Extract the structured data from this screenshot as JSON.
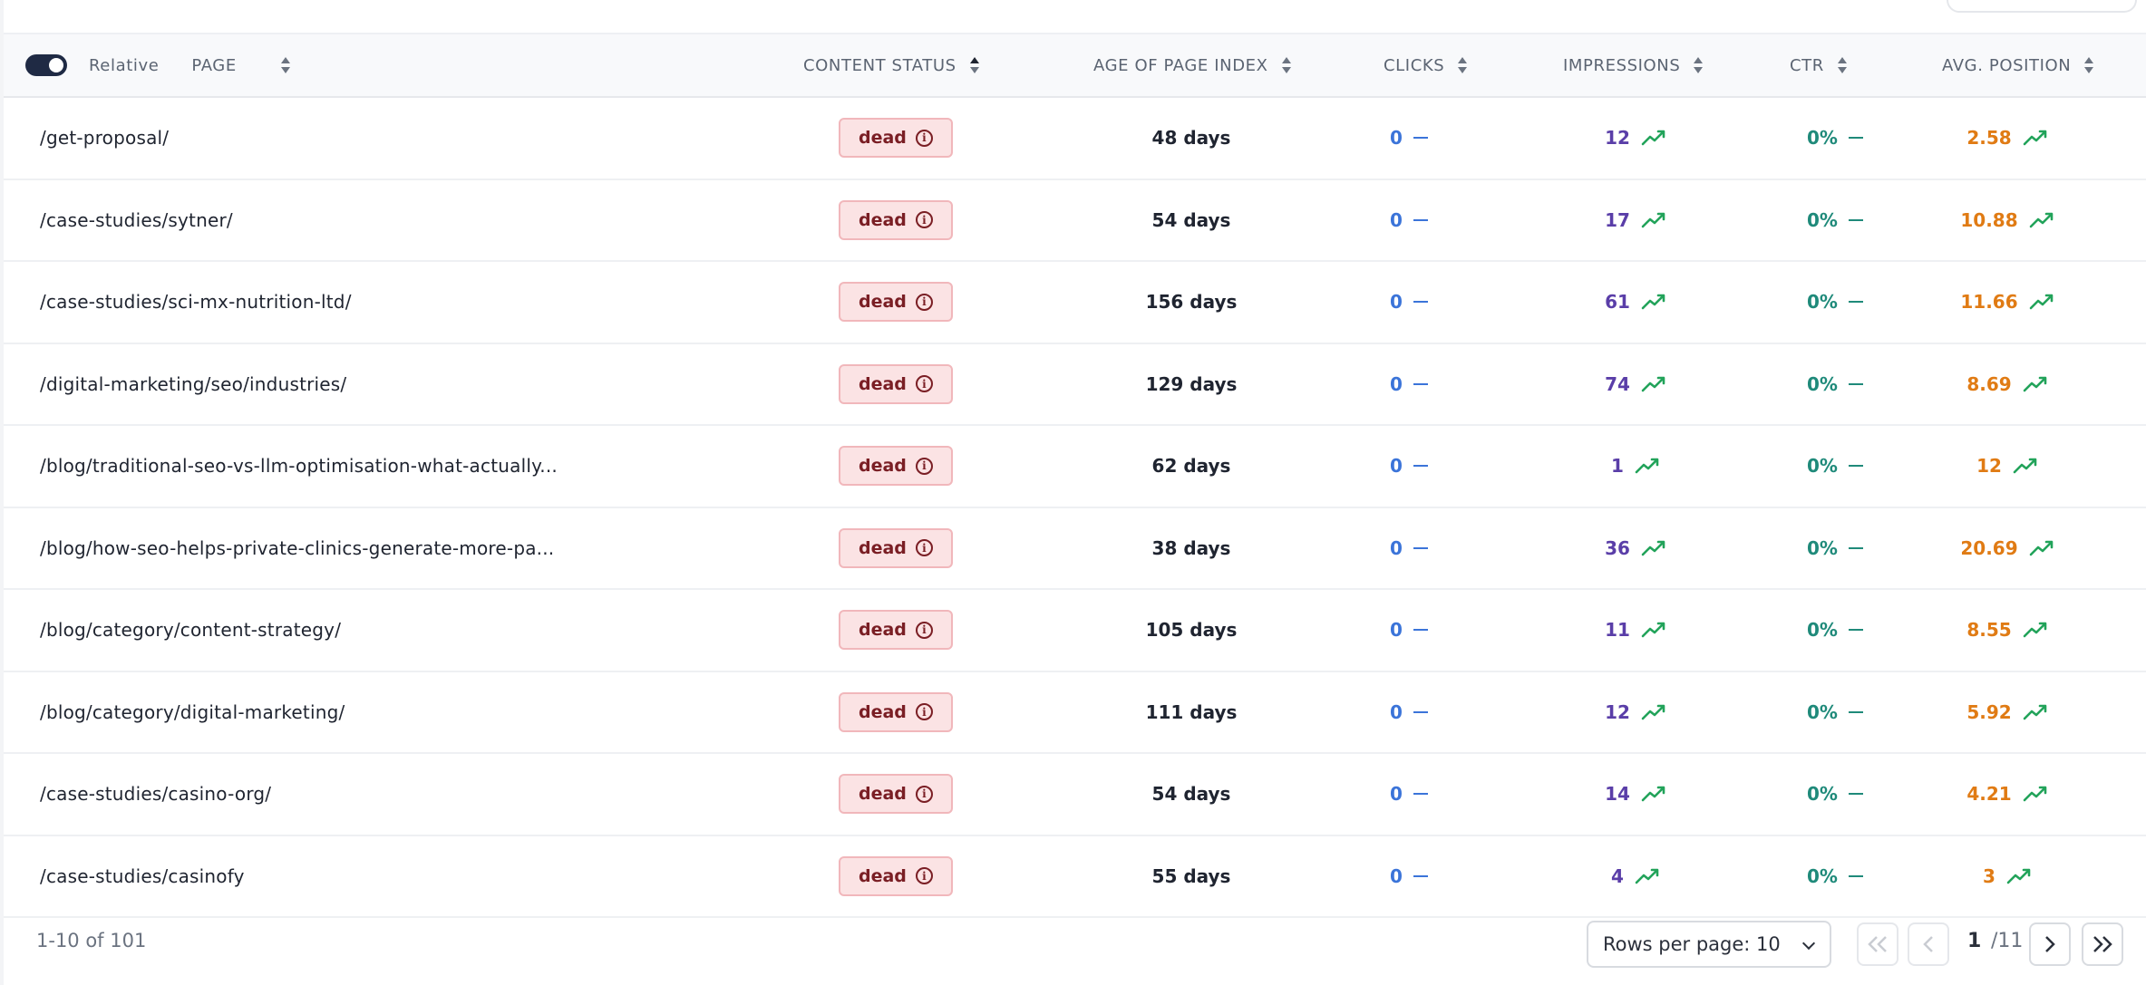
{
  "toggle": {
    "label": "Relative",
    "on": true
  },
  "columns": {
    "page": "PAGE",
    "content_status": "CONTENT STATUS",
    "age": "AGE OF PAGE INDEX",
    "clicks": "CLICKS",
    "impressions": "IMPRESSIONS",
    "ctr": "CTR",
    "avg_position": "AVG. POSITION"
  },
  "rows": [
    {
      "page": "/get-proposal/",
      "status": "dead",
      "age": "48 days",
      "clicks": "0",
      "impressions": "12",
      "ctr": "0%",
      "position": "2.58"
    },
    {
      "page": "/case-studies/sytner/",
      "status": "dead",
      "age": "54 days",
      "clicks": "0",
      "impressions": "17",
      "ctr": "0%",
      "position": "10.88"
    },
    {
      "page": "/case-studies/sci-mx-nutrition-ltd/",
      "status": "dead",
      "age": "156 days",
      "clicks": "0",
      "impressions": "61",
      "ctr": "0%",
      "position": "11.66"
    },
    {
      "page": "/digital-marketing/seo/industries/",
      "status": "dead",
      "age": "129 days",
      "clicks": "0",
      "impressions": "74",
      "ctr": "0%",
      "position": "8.69"
    },
    {
      "page": "/blog/traditional-seo-vs-llm-optimisation-what-actually...",
      "status": "dead",
      "age": "62 days",
      "clicks": "0",
      "impressions": "1",
      "ctr": "0%",
      "position": "12"
    },
    {
      "page": "/blog/how-seo-helps-private-clinics-generate-more-pa...",
      "status": "dead",
      "age": "38 days",
      "clicks": "0",
      "impressions": "36",
      "ctr": "0%",
      "position": "20.69"
    },
    {
      "page": "/blog/category/content-strategy/",
      "status": "dead",
      "age": "105 days",
      "clicks": "0",
      "impressions": "11",
      "ctr": "0%",
      "position": "8.55"
    },
    {
      "page": "/blog/category/digital-marketing/",
      "status": "dead",
      "age": "111 days",
      "clicks": "0",
      "impressions": "12",
      "ctr": "0%",
      "position": "5.92"
    },
    {
      "page": "/case-studies/casino-org/",
      "status": "dead",
      "age": "54 days",
      "clicks": "0",
      "impressions": "14",
      "ctr": "0%",
      "position": "4.21"
    },
    {
      "page": "/case-studies/casinofy",
      "status": "dead",
      "age": "55 days",
      "clicks": "0",
      "impressions": "4",
      "ctr": "0%",
      "position": "3"
    }
  ],
  "icons": {
    "status_info": "info-icon",
    "trend_up": "trend-up-icon",
    "flat": "dash-icon"
  },
  "colors": {
    "clicks": "#3b74d9",
    "impressions": "#5a3ea8",
    "ctr": "#1f8a7a",
    "position": "#e07b14",
    "trend": "#22a35a",
    "badge_bg": "#fbe3e4"
  },
  "footer": {
    "range_text": "1-10 of 101",
    "rows_per_page": "Rows per page: 10",
    "current_page": "1",
    "total_pages": "/11"
  }
}
